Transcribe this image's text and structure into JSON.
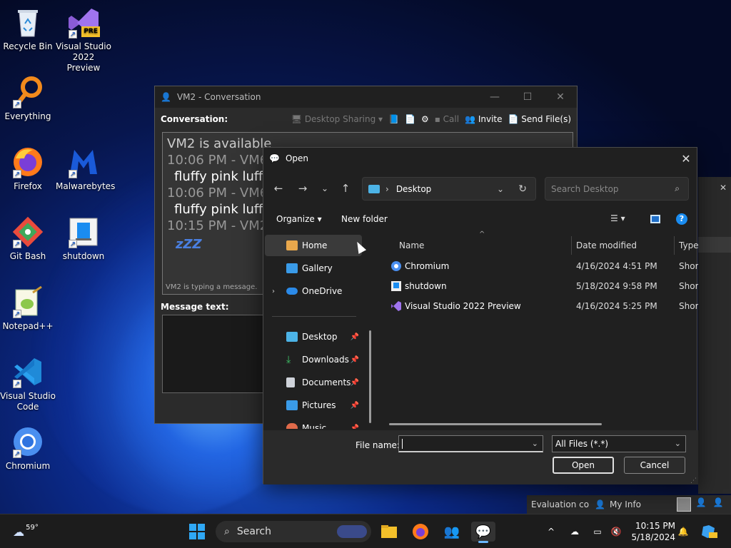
{
  "desktop": {
    "icons": [
      {
        "label": "Recycle Bin",
        "icon": "recycle-bin-icon"
      },
      {
        "label": "Visual Studio\n2022 Preview",
        "line1": "Visual Studio",
        "line2": "2022 Preview",
        "badge": "PRE",
        "icon": "visual-studio-preview-icon"
      },
      {
        "label": "Everything",
        "icon": "everything-search-icon"
      },
      {
        "label": "Firefox",
        "icon": "firefox-icon"
      },
      {
        "label": "Malwarebytes",
        "icon": "malwarebytes-icon"
      },
      {
        "label": "Git Bash",
        "icon": "git-bash-icon"
      },
      {
        "label": "shutdown",
        "icon": "shutdown-shortcut-icon"
      },
      {
        "label": "Notepad++",
        "icon": "notepad-plus-plus-icon"
      },
      {
        "label": "Visual Studio Code",
        "line1": "Visual Studio",
        "line2": "Code",
        "icon": "vscode-icon"
      },
      {
        "label": "Chromium",
        "icon": "chromium-icon"
      }
    ]
  },
  "conversation": {
    "title": "VM2 - Conversation",
    "label": "Conversation:",
    "toolbar": {
      "desktop_sharing": "Desktop Sharing",
      "call": "Call",
      "invite": "Invite",
      "send_files": "Send File(s)"
    },
    "log": {
      "status": "VM2 is available",
      "entries": [
        {
          "time": "10:06 PM - VM6",
          "message": "fluffy pink luffy"
        },
        {
          "time": "10:06 PM - VM6",
          "message": "fluffy pink luffy"
        }
      ],
      "last_time": "10:15 PM - VM2",
      "zzz": "zZZ",
      "typing": "VM2 is typing a message."
    },
    "message_label": "Message text:"
  },
  "dialog": {
    "title": "Open",
    "address": {
      "location": "Desktop"
    },
    "search_placeholder": "Search Desktop",
    "commands": {
      "organize": "Organize",
      "new_folder": "New folder"
    },
    "nav": [
      {
        "label": "Home",
        "selected": true
      },
      {
        "label": "Gallery"
      },
      {
        "label": "OneDrive"
      },
      {
        "label": "Desktop",
        "pinned": true
      },
      {
        "label": "Downloads",
        "pinned": true
      },
      {
        "label": "Documents",
        "pinned": true
      },
      {
        "label": "Pictures",
        "pinned": true
      },
      {
        "label": "Music",
        "pinned": true
      }
    ],
    "columns": {
      "name": "Name",
      "date": "Date modified",
      "type": "Type"
    },
    "files": [
      {
        "name": "Chromium",
        "date": "4/16/2024 4:51 PM",
        "type": "Short"
      },
      {
        "name": "shutdown",
        "date": "5/18/2024 9:58 PM",
        "type": "Short"
      },
      {
        "name": "Visual Studio 2022 Preview",
        "date": "4/16/2024 5:25 PM",
        "type": "Short"
      }
    ],
    "file_name_label": "File name:",
    "file_name_value": "",
    "filter": "All Files (*.*)",
    "open_button": "Open",
    "cancel_button": "Cancel"
  },
  "background_strip": {
    "evaluation": "Evaluation co",
    "my_info": "My Info"
  },
  "taskbar": {
    "weather": "59°",
    "search": "Search",
    "time": "10:15 PM",
    "date": "5/18/2024"
  }
}
